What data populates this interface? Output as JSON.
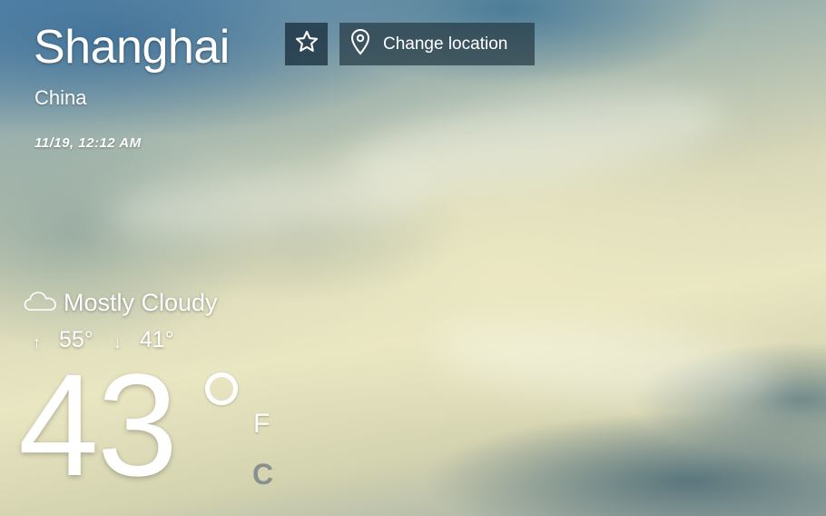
{
  "location": {
    "city": "Shanghai",
    "country": "China",
    "datetime": "11/19, 12:12 AM"
  },
  "toolbar": {
    "favorite_icon": "star-outline-icon",
    "change_location_icon": "map-pin-icon",
    "change_location_label": "Change location"
  },
  "weather": {
    "condition_icon": "cloud-icon",
    "condition": "Mostly Cloudy",
    "high": "55°",
    "low": "41°",
    "high_arrow": "↑",
    "low_arrow": "↓",
    "temperature": "43",
    "unit_f": "F",
    "unit_c": "C",
    "selected_unit": "F"
  }
}
